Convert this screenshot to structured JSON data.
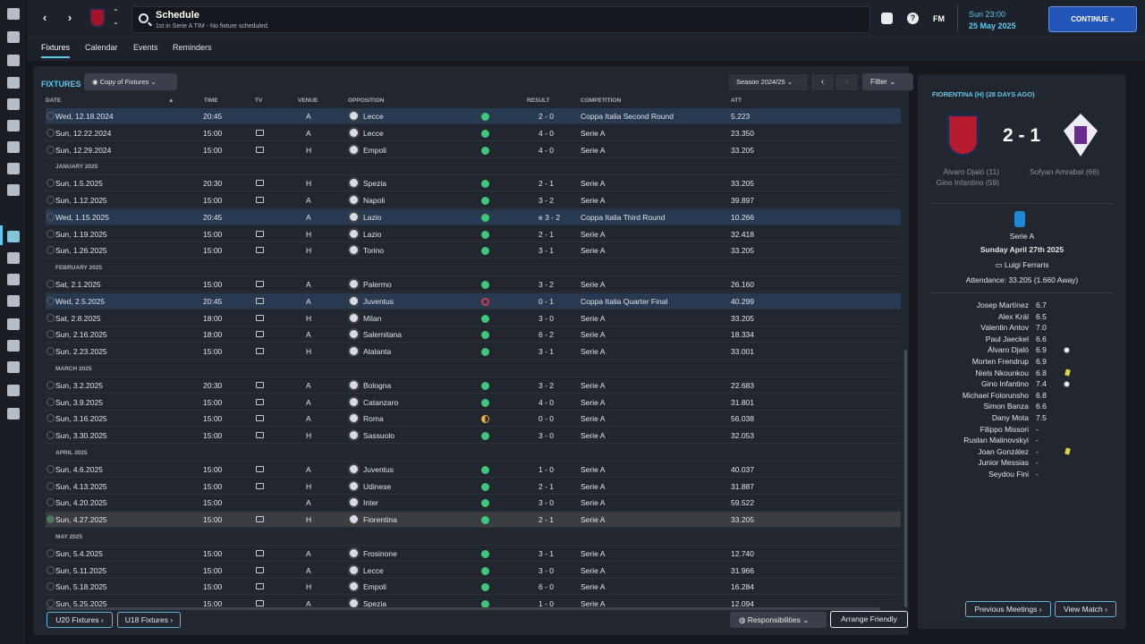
{
  "header": {
    "title": "Schedule",
    "subtitle": "1st in Serie A TIM - No fixture scheduled.",
    "fm_label": "FM",
    "date_time": "Sun 23:00",
    "date": "25 May 2025",
    "continue_label": "CONTINUE",
    "help_glyph": "?"
  },
  "nav": {
    "back": "‹",
    "forward": "›",
    "up": "⌃",
    "down": "⌄"
  },
  "subtabs": [
    "Fixtures",
    "Calendar",
    "Events",
    "Reminders"
  ],
  "panel": {
    "title": "FIXTURES",
    "view_label": "Copy of Fixtures",
    "season_label": "Season 2024/25",
    "filter_label": "Filter",
    "prev": "‹",
    "next": "›"
  },
  "columns": {
    "date": "DATE",
    "time": "TIME",
    "tv": "TV",
    "venue": "VENUE",
    "opposition": "OPPOSITION",
    "result": "RESULT",
    "competition": "COMPETITION",
    "att": "ATT"
  },
  "fixtures": [
    {
      "type": "match",
      "date": "Wed, 12.18.2024",
      "time": "20:45",
      "tv": false,
      "venue": "A",
      "opp": "Lecce",
      "result": "2 - 0",
      "outcome": "win",
      "comp": "Coppa Italia Second Round",
      "att": "5.223",
      "cup": true
    },
    {
      "type": "match",
      "date": "Sun, 12.22.2024",
      "time": "15:00",
      "tv": true,
      "venue": "A",
      "opp": "Lecce",
      "result": "4 - 0",
      "outcome": "win",
      "comp": "Serie A",
      "att": "23.350"
    },
    {
      "type": "match",
      "date": "Sun, 12.29.2024",
      "time": "15:00",
      "tv": true,
      "venue": "H",
      "opp": "Empoli",
      "result": "4 - 0",
      "outcome": "win",
      "comp": "Serie A",
      "att": "33.205"
    },
    {
      "type": "month",
      "label": "JANUARY 2025"
    },
    {
      "type": "match",
      "date": "Sun, 1.5.2025",
      "time": "20:30",
      "tv": true,
      "venue": "H",
      "opp": "Spezia",
      "result": "2 - 1",
      "outcome": "win",
      "comp": "Serie A",
      "att": "33.205"
    },
    {
      "type": "match",
      "date": "Sun, 1.12.2025",
      "time": "15:00",
      "tv": true,
      "venue": "A",
      "opp": "Napoli",
      "result": "3 - 2",
      "outcome": "win",
      "comp": "Serie A",
      "att": "39.897"
    },
    {
      "type": "match",
      "date": "Wed, 1.15.2025",
      "time": "20:45",
      "tv": false,
      "venue": "A",
      "opp": "Lazio",
      "result": "e 3 - 2",
      "outcome": "win",
      "comp": "Coppa Italia Third Round",
      "att": "10.266",
      "cup": true
    },
    {
      "type": "match",
      "date": "Sun, 1.19.2025",
      "time": "15:00",
      "tv": true,
      "venue": "H",
      "opp": "Lazio",
      "result": "2 - 1",
      "outcome": "win",
      "comp": "Serie A",
      "att": "32.418"
    },
    {
      "type": "match",
      "date": "Sun, 1.26.2025",
      "time": "15:00",
      "tv": true,
      "venue": "H",
      "opp": "Torino",
      "result": "3 - 1",
      "outcome": "win",
      "comp": "Serie A",
      "att": "33.205"
    },
    {
      "type": "month",
      "label": "FEBRUARY 2025"
    },
    {
      "type": "match",
      "date": "Sat, 2.1.2025",
      "time": "15:00",
      "tv": true,
      "venue": "A",
      "opp": "Palermo",
      "result": "3 - 2",
      "outcome": "win",
      "comp": "Serie A",
      "att": "26.160"
    },
    {
      "type": "match",
      "date": "Wed, 2.5.2025",
      "time": "20:45",
      "tv": true,
      "venue": "A",
      "opp": "Juventus",
      "result": "0 - 1",
      "outcome": "loss",
      "comp": "Coppa Italia Quarter Final",
      "att": "40.299",
      "cup": true
    },
    {
      "type": "match",
      "date": "Sat, 2.8.2025",
      "time": "18:00",
      "tv": true,
      "venue": "H",
      "opp": "Milan",
      "result": "3 - 0",
      "outcome": "win",
      "comp": "Serie A",
      "att": "33.205"
    },
    {
      "type": "match",
      "date": "Sun, 2.16.2025",
      "time": "18:00",
      "tv": true,
      "venue": "A",
      "opp": "Salernitana",
      "result": "6 - 2",
      "outcome": "win",
      "comp": "Serie A",
      "att": "18.334"
    },
    {
      "type": "match",
      "date": "Sun, 2.23.2025",
      "time": "15:00",
      "tv": true,
      "venue": "H",
      "opp": "Atalanta",
      "result": "3 - 1",
      "outcome": "win",
      "comp": "Serie A",
      "att": "33.001"
    },
    {
      "type": "month",
      "label": "MARCH 2025"
    },
    {
      "type": "match",
      "date": "Sun, 3.2.2025",
      "time": "20:30",
      "tv": true,
      "venue": "A",
      "opp": "Bologna",
      "result": "3 - 2",
      "outcome": "win",
      "comp": "Serie A",
      "att": "22.683"
    },
    {
      "type": "match",
      "date": "Sun, 3.9.2025",
      "time": "15:00",
      "tv": true,
      "venue": "A",
      "opp": "Catanzaro",
      "result": "4 - 0",
      "outcome": "win",
      "comp": "Serie A",
      "att": "31.801"
    },
    {
      "type": "match",
      "date": "Sun, 3.16.2025",
      "time": "15:00",
      "tv": true,
      "venue": "A",
      "opp": "Roma",
      "result": "0 - 0",
      "outcome": "draw",
      "comp": "Serie A",
      "att": "56.038"
    },
    {
      "type": "match",
      "date": "Sun, 3.30.2025",
      "time": "15:00",
      "tv": true,
      "venue": "H",
      "opp": "Sassuolo",
      "result": "3 - 0",
      "outcome": "win",
      "comp": "Serie A",
      "att": "32.053"
    },
    {
      "type": "month",
      "label": "APRIL 2025"
    },
    {
      "type": "match",
      "date": "Sun, 4.6.2025",
      "time": "15:00",
      "tv": true,
      "venue": "A",
      "opp": "Juventus",
      "result": "1 - 0",
      "outcome": "win",
      "comp": "Serie A",
      "att": "40.037"
    },
    {
      "type": "match",
      "date": "Sun, 4.13.2025",
      "time": "15:00",
      "tv": true,
      "venue": "H",
      "opp": "Udinese",
      "result": "2 - 1",
      "outcome": "win",
      "comp": "Serie A",
      "att": "31.887"
    },
    {
      "type": "match",
      "date": "Sun, 4.20.2025",
      "time": "15:00",
      "tv": false,
      "venue": "A",
      "opp": "Inter",
      "result": "3 - 0",
      "outcome": "win",
      "comp": "Serie A",
      "att": "59.522"
    },
    {
      "type": "match",
      "date": "Sun, 4.27.2025",
      "time": "15:00",
      "tv": true,
      "venue": "H",
      "opp": "Fiorentina",
      "result": "2 - 1",
      "outcome": "win",
      "comp": "Serie A",
      "att": "33.205",
      "selected": true
    },
    {
      "type": "month",
      "label": "MAY 2025"
    },
    {
      "type": "match",
      "date": "Sun, 5.4.2025",
      "time": "15:00",
      "tv": true,
      "venue": "A",
      "opp": "Frosinone",
      "result": "3 - 1",
      "outcome": "win",
      "comp": "Serie A",
      "att": "12.740"
    },
    {
      "type": "match",
      "date": "Sun, 5.11.2025",
      "time": "15:00",
      "tv": true,
      "venue": "A",
      "opp": "Lecce",
      "result": "3 - 0",
      "outcome": "win",
      "comp": "Serie A",
      "att": "31.966"
    },
    {
      "type": "match",
      "date": "Sun, 5.18.2025",
      "time": "15:00",
      "tv": true,
      "venue": "H",
      "opp": "Empoli",
      "result": "6 - 0",
      "outcome": "win",
      "comp": "Serie A",
      "att": "16.284"
    },
    {
      "type": "match",
      "date": "Sun, 5.25.2025",
      "time": "15:00",
      "tv": true,
      "venue": "A",
      "opp": "Spezia",
      "result": "1 - 0",
      "outcome": "win",
      "comp": "Serie A",
      "att": "12.094"
    }
  ],
  "footer": {
    "u20": "U20 Fixtures",
    "u18": "U18 Fixtures",
    "responsibilities": "Responsibilities",
    "arrange": "Arrange Friendly"
  },
  "match_detail": {
    "title": "FIORENTINA (H) (28 DAYS AGO)",
    "score": "2 - 1",
    "home_scorers": [
      "Álvaro Djaló (11)",
      "Gino Infantino (59)"
    ],
    "away_scorers": [
      "Sofyan Amrabat (66)"
    ],
    "competition": "Serie A",
    "date": "Sunday April 27th 2025",
    "stadium": "Luigi Ferraris",
    "attendance": "Attendance: 33.205 (1.660 Away)",
    "players": [
      {
        "name": "Josep Martínez",
        "rating": "6.7"
      },
      {
        "name": "Alex Král",
        "rating": "6.5"
      },
      {
        "name": "Valentin Antov",
        "rating": "7.0"
      },
      {
        "name": "Paul Jaeckel",
        "rating": "6.6"
      },
      {
        "name": "Álvaro Djaló",
        "rating": "6.9",
        "icon": "ball"
      },
      {
        "name": "Morten Frendrup",
        "rating": "6.9"
      },
      {
        "name": "Niels Nkounkou",
        "rating": "6.8",
        "icon": "yellow"
      },
      {
        "name": "Gino Infantino",
        "rating": "7.4",
        "icon": "ball"
      },
      {
        "name": "Michael Folorunsho",
        "rating": "6.8"
      },
      {
        "name": "Simon Banza",
        "rating": "6.6"
      },
      {
        "name": "Dany Mota",
        "rating": "7.5"
      },
      {
        "name": "Filippo Missori",
        "rating": "-"
      },
      {
        "name": "Ruslan Malinovskyi",
        "rating": "-"
      },
      {
        "name": "Joan González",
        "rating": "-",
        "icon": "yellow"
      },
      {
        "name": "Junior Messias",
        "rating": "-"
      },
      {
        "name": "Seydou Fini",
        "rating": "-"
      }
    ],
    "prev_meetings": "Previous Meetings",
    "view_match": "View Match"
  }
}
